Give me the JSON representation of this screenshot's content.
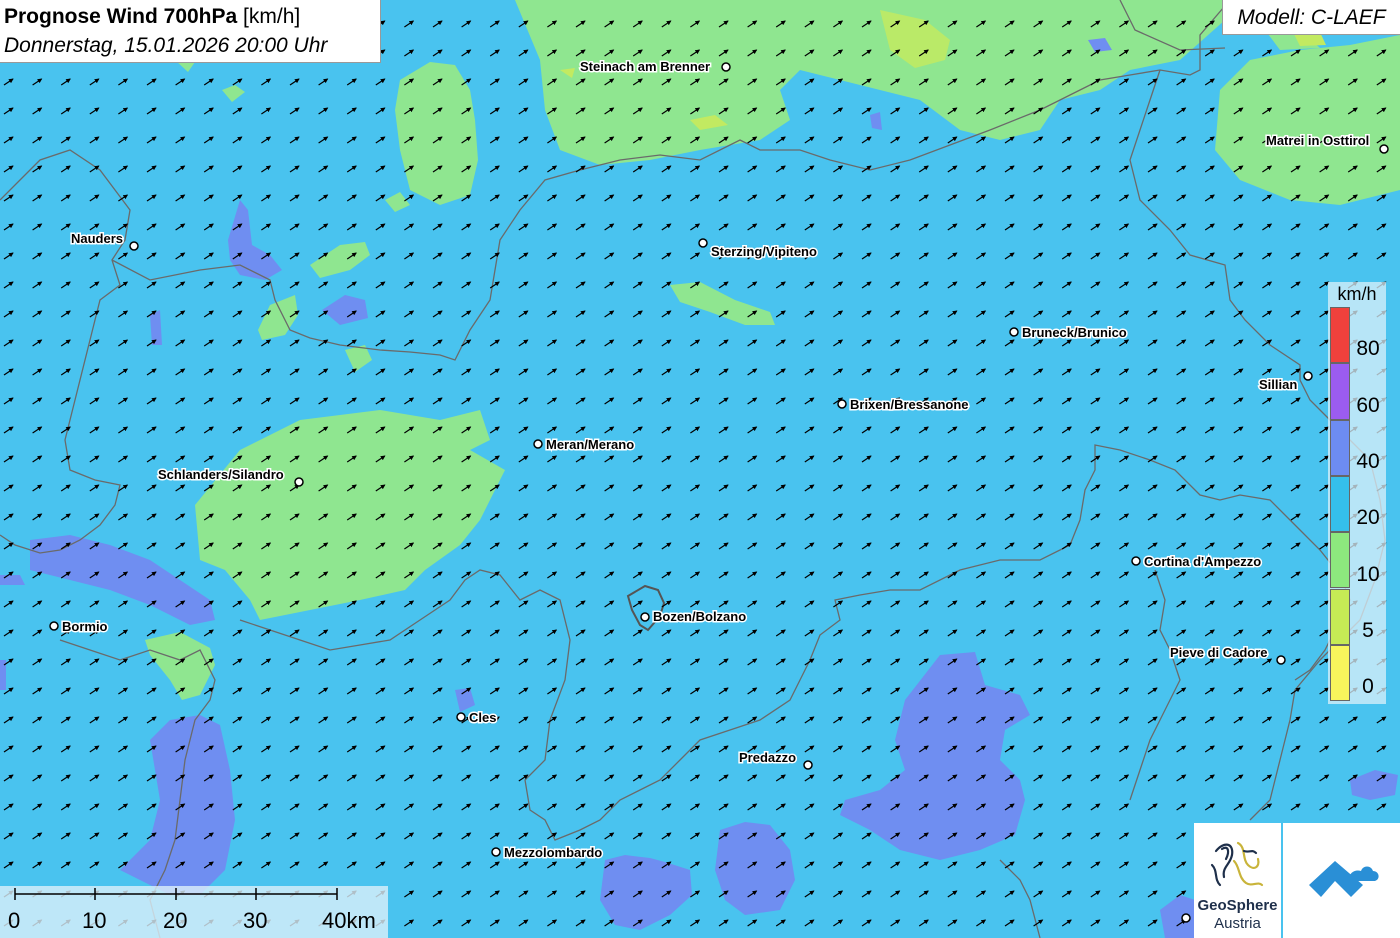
{
  "title": {
    "main": "Prognose Wind 700hPa",
    "unit": "[km/h]",
    "datetime": "Donnerstag, 15.01.2026 20:00 Uhr"
  },
  "model": "Modell: C-LAEF",
  "legend": {
    "unit": "km/h",
    "labels": [
      "80",
      "60",
      "40",
      "20",
      "10",
      "5",
      "0"
    ],
    "bands": [
      {
        "min": 80,
        "color": "#f0413c"
      },
      {
        "min": 60,
        "color": "#9b5cf0"
      },
      {
        "min": 40,
        "color": "#6d8cf2"
      },
      {
        "min": 20,
        "color": "#35bfeb"
      },
      {
        "min": 10,
        "color": "#8de87e"
      },
      {
        "min": 5,
        "color": "#c6ea55"
      },
      {
        "min": 0,
        "color": "#f8f55c"
      }
    ]
  },
  "scale": {
    "labels": [
      "0",
      "10",
      "20",
      "30",
      "40km"
    ]
  },
  "cities": [
    "Steinach am Brenner",
    "Matrei in Osttirol",
    "Nauders",
    "Sterzing/Vipiteno",
    "Bruneck/Brunico",
    "Sillian",
    "Brixen/Bressanone",
    "Meran/Merano",
    "Schlanders/Silandro",
    "Cortina d'Ampezzo",
    "Bozen/Bolzano",
    "Bormio",
    "Pieve di Cadore",
    "Cles",
    "Predazzo",
    "Mezzolombardo"
  ],
  "logo": {
    "line1": "GeoSphere",
    "line2": "Austria"
  }
}
